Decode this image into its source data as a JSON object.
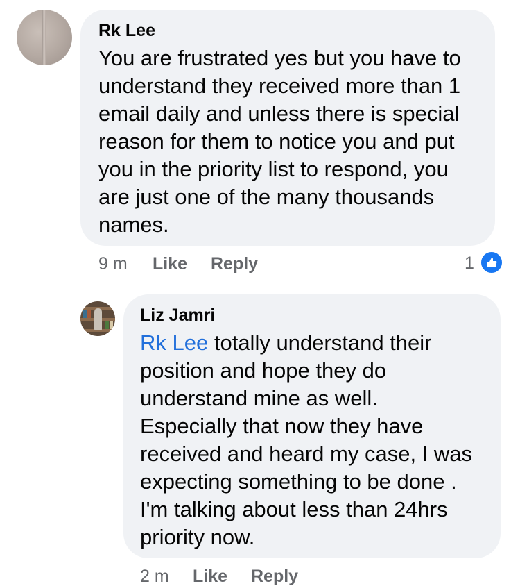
{
  "comments": [
    {
      "author": "Rk Lee",
      "text": "You are frustrated yes but you have to understand they received more than 1 email daily and unless there is special reason for them to notice you and put you in the priority list to respond, you are just one of the many thousands names.",
      "time": "9 m",
      "like_label": "Like",
      "reply_label": "Reply",
      "reaction_count": "1",
      "reaction_icon": "thumbs-up-icon",
      "reaction_color": "#1877f2"
    }
  ],
  "replies": [
    {
      "author": "Liz Jamri",
      "mention": "Rk Lee",
      "text": " totally understand their position and hope they do understand mine as well. Especially that now they have received and heard my case, I was expecting something to be done . I'm talking about less than 24hrs priority now.",
      "time": "2 m",
      "like_label": "Like",
      "reply_label": "Reply"
    }
  ],
  "colors": {
    "bubble": "#f0f2f5",
    "meta_text": "#65676b",
    "mention": "#216fdb"
  }
}
